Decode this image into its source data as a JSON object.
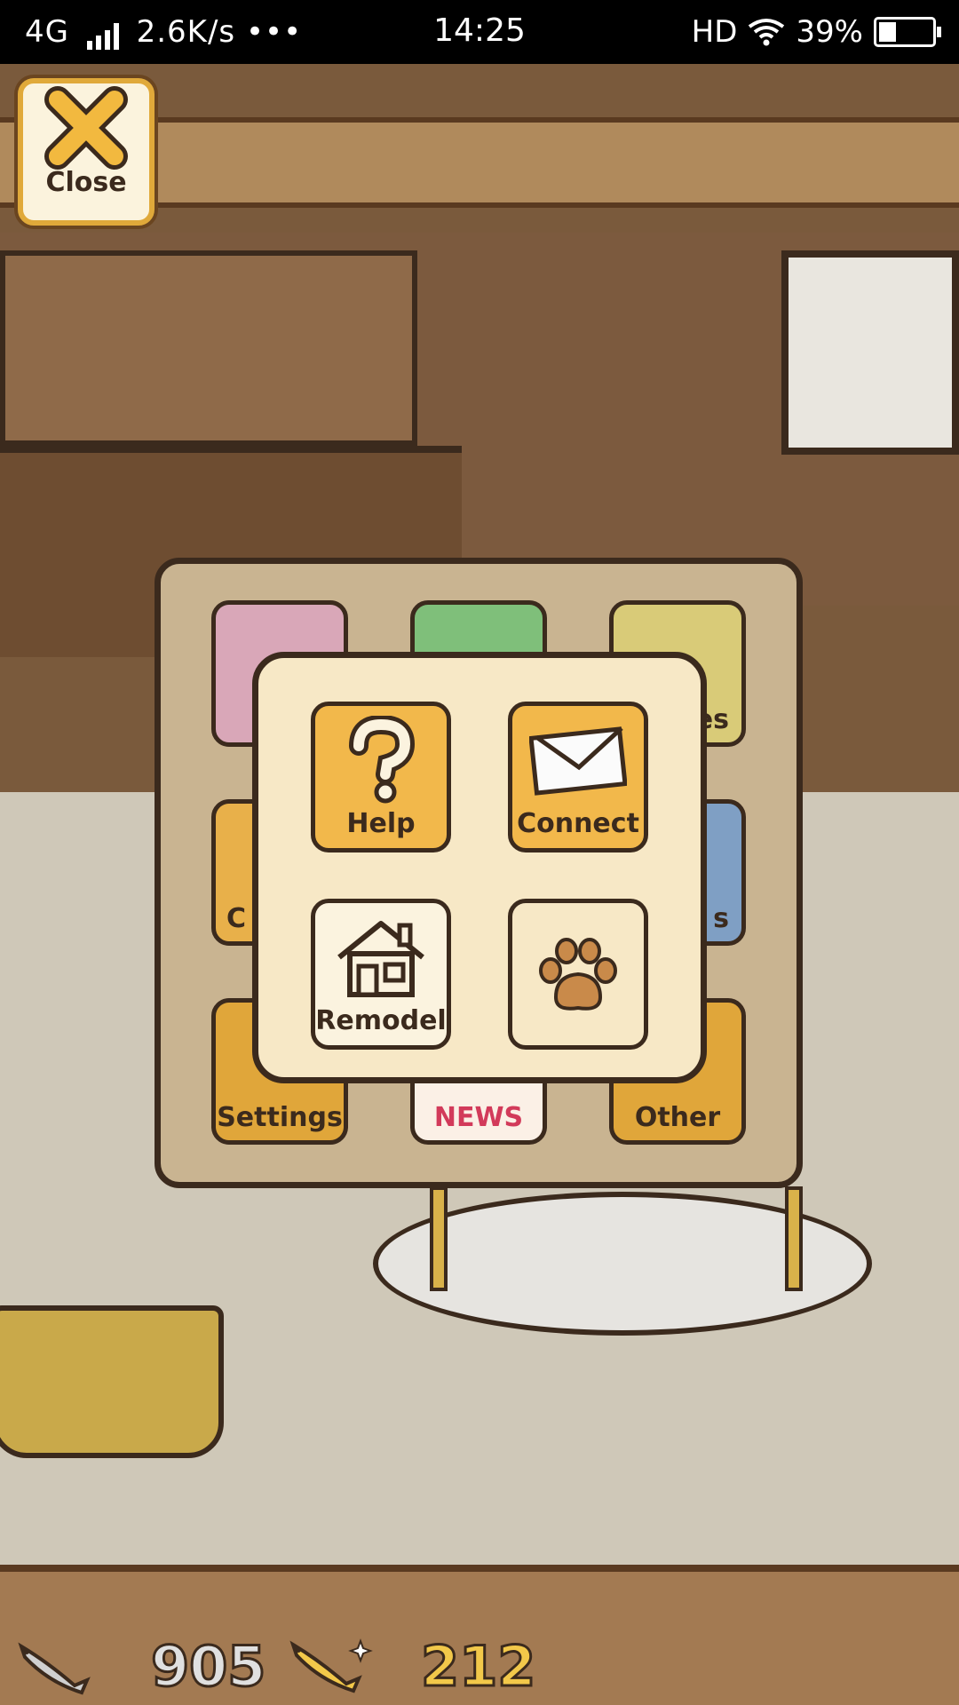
{
  "status_bar": {
    "network": "4G",
    "speed": "2.6K/s",
    "more": "•••",
    "time": "14:25",
    "hd": "HD",
    "battery": "39%"
  },
  "close_button": {
    "label": "Close"
  },
  "background_tiles": [
    {
      "label": "",
      "color": "#d9a7b8"
    },
    {
      "label": "",
      "color": "#7fbf7a"
    },
    {
      "label": "es",
      "color": "#d9cb78"
    },
    {
      "label": "C",
      "color": "#e8b04a"
    },
    {
      "label": "s",
      "color": "#7f9fc4"
    },
    {
      "label": "Settings",
      "color": "#e0a63a"
    },
    {
      "label": "NEWS",
      "color": "#fbf0e6"
    },
    {
      "label": "Other",
      "color": "#e0a63a"
    }
  ],
  "popup_buttons": [
    {
      "label": "Help",
      "icon": "help-icon"
    },
    {
      "label": "Connect",
      "icon": "envelope-icon"
    },
    {
      "label": "Remodel",
      "icon": "house-icon"
    },
    {
      "label": "",
      "icon": "paw-icon"
    }
  ],
  "hud": {
    "silver_fish": "905",
    "gold_fish": "212",
    "silver_color": "#e0e0e0",
    "gold_color": "#f2c84a"
  }
}
